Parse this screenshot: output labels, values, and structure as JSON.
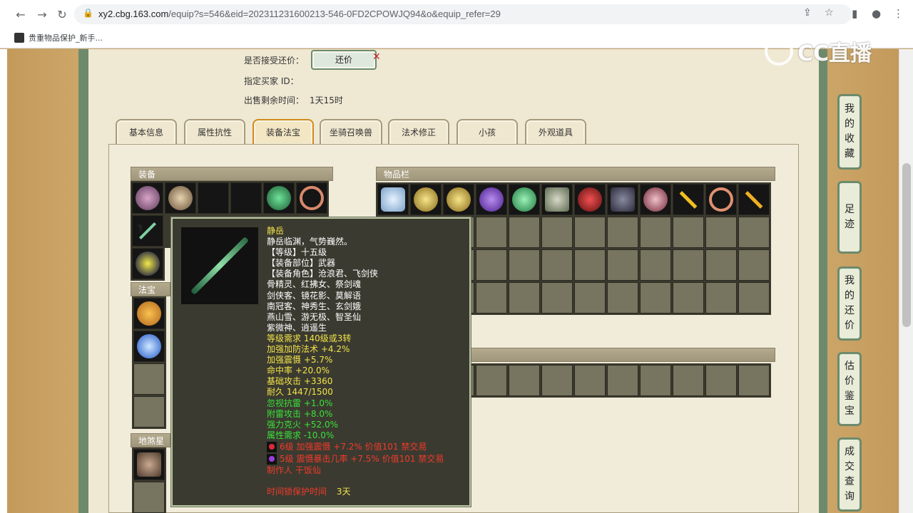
{
  "browser": {
    "url_host": "xy2.cbg.163.com",
    "url_path": "/equip?s=546&eid=202311231600213-546-0FD2CPOWJQ94&o&equip_refer=29",
    "bookmark_label": "贵重物品保护_新手..."
  },
  "sale_info": {
    "accept_counter_label": "是否接受还价：",
    "counter_button": "还价",
    "buyer_id_label": "指定买家 ID：",
    "remaining_label": "出售剩余时间：",
    "remaining_value": "1天15时"
  },
  "tabs": [
    "基本信息",
    "属性抗性",
    "装备法宝",
    "坐骑召唤兽",
    "法术修正",
    "小孩",
    "外观道具"
  ],
  "panels": {
    "equipment": "装备",
    "fabao": "法宝",
    "dishan": "地煞星历",
    "inventory": "物品栏"
  },
  "logo": {
    "text": "CC直播"
  },
  "side_buttons": [
    [
      "我",
      "的",
      "收",
      "藏"
    ],
    [
      "足",
      "迹"
    ],
    [
      "我",
      "的",
      "还",
      "价"
    ],
    [
      "估",
      "价",
      "鉴",
      "宝"
    ],
    [
      "成",
      "交",
      "查",
      "询"
    ]
  ],
  "tooltip": {
    "name": "静岳",
    "desc": "静岳临渊，气势巍然。",
    "level": "【等级】十五级",
    "slot": "【装备部位】武器",
    "roles_label": "【装备角色】沧浪君、飞剑侠",
    "roles": [
      "骨精灵、红拂女、祭剑魂",
      "剑侠客、镜花影、莫解语",
      "南冠客、神秀生、玄剑娥",
      "燕山雪、游无极、智圣仙",
      "紫微神、逍遥生"
    ],
    "yellow_stats": [
      "等级需求 140级或3转",
      "加强加防法术 +4.2%",
      "加强震慑 +5.7%",
      "命中率 +20.0%",
      "基础攻击 +3360",
      "耐久 1447/1500"
    ],
    "green_stats": [
      "忽视抗雷 +1.0%",
      "附雷攻击 +8.0%",
      "强力克火 +52.0%",
      "属性需求 -10.0%"
    ],
    "gems": [
      {
        "text": "6级 加强震慑 +7.2% 价值101 禁交易",
        "color": "#e0283a"
      },
      {
        "text": "5级 震慑暴击几率 +7.5% 价值101 禁交易",
        "color": "#9b3ee0"
      }
    ],
    "maker": "制作人 干饭仙",
    "protect_label": "时间锁保护时间",
    "protect_value": "3天"
  }
}
